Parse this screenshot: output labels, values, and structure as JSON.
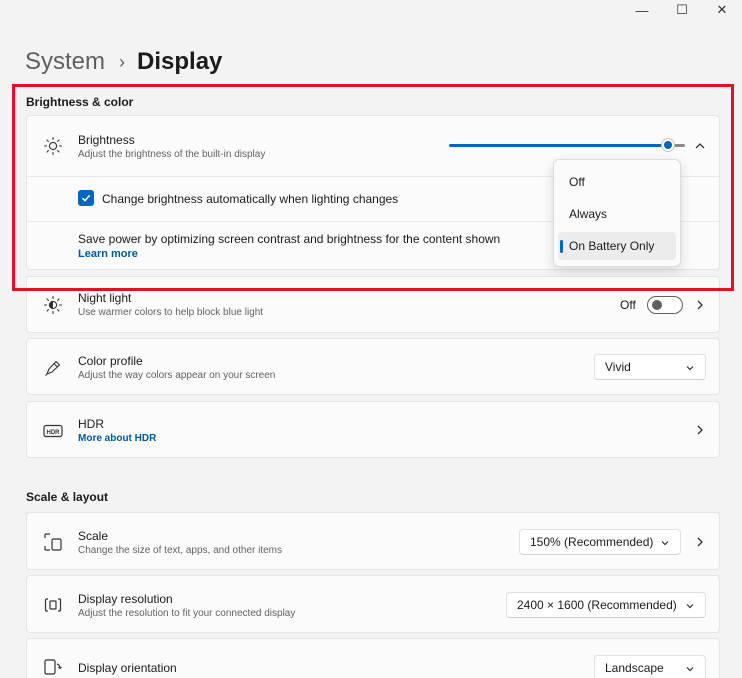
{
  "window_controls": {
    "minimize": "—",
    "maximize": "☐",
    "close": "✕"
  },
  "breadcrumb": {
    "parent": "System",
    "separator": "›",
    "current": "Display"
  },
  "brightness_color": {
    "section_title": "Brightness & color",
    "brightness": {
      "title": "Brightness",
      "subtitle": "Adjust the brightness of the built-in display",
      "level_fraction": 0.93
    },
    "auto_brightness": {
      "label": "Change brightness automatically when lighting changes",
      "checked": true
    },
    "content_adaptive": {
      "label": "Save power by optimizing screen contrast and brightness for the content shown",
      "link": "Learn more"
    },
    "popup": {
      "options": [
        "Off",
        "Always",
        "On Battery Only"
      ],
      "selected": "On Battery Only"
    }
  },
  "night_light": {
    "title": "Night light",
    "subtitle": "Use warmer colors to help block blue light",
    "state": "Off"
  },
  "color_profile": {
    "title": "Color profile",
    "subtitle": "Adjust the way colors appear on your screen",
    "value": "Vivid"
  },
  "hdr": {
    "title": "HDR",
    "link": "More about HDR"
  },
  "scale_layout": {
    "section_title": "Scale & layout",
    "scale": {
      "title": "Scale",
      "subtitle": "Change the size of text, apps, and other items",
      "value": "150% (Recommended)"
    },
    "resolution": {
      "title": "Display resolution",
      "subtitle": "Adjust the resolution to fit your connected display",
      "value": "2400 × 1600 (Recommended)"
    },
    "orientation": {
      "title": "Display orientation",
      "value": "Landscape"
    }
  },
  "colors": {
    "accent": "#0067c0",
    "highlight": "#e0141e",
    "link": "#005a9e"
  }
}
